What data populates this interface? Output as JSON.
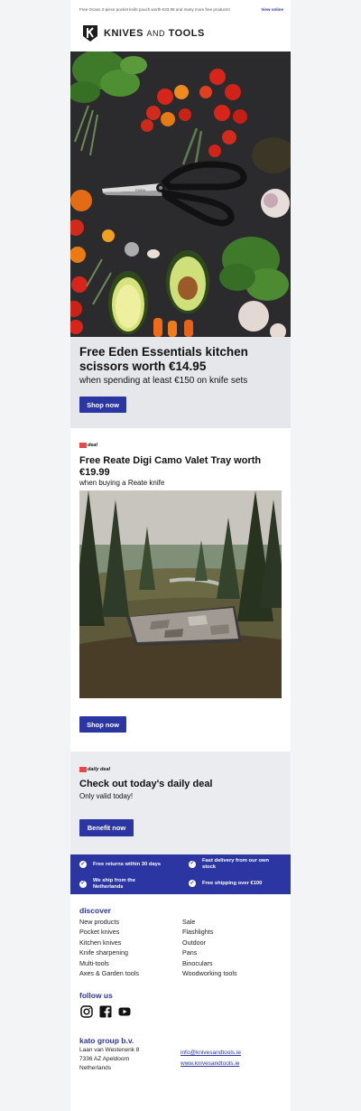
{
  "preheader": {
    "text": "Free Ocaso 2-piece pocket knife pouch worth €33.99 and many more free products!",
    "view_online": "View online"
  },
  "brand": {
    "name": "KNIVES",
    "and": "AND",
    "name2": "TOOLS"
  },
  "hero": {
    "scissors_mark": "EDEN",
    "title": "Free Eden Essentials kitchen scissors worth €14.95",
    "subtitle": "when spending at least €150 on knife sets",
    "button": "Shop now"
  },
  "deal": {
    "tag": "deal",
    "title": "Free Reate Digi Camo Valet Tray worth €19.99",
    "subtitle": "when buying a Reate knife",
    "button": "Shop now"
  },
  "daily_deal": {
    "tag": "daily deal",
    "title": "Check out today's daily deal",
    "subtitle": "Only valid today!",
    "button": "Benefit now"
  },
  "usps": [
    "Free returns within 30 days",
    "Fast delivery from our own stock",
    "We ship from the Netherlands",
    "Free shipping over €100"
  ],
  "discover": {
    "title": "discover",
    "col1": [
      "New products",
      "Pocket knives",
      "Kitchen knives",
      "Knife sharpening",
      "Multi-tools",
      "Axes & Garden tools"
    ],
    "col2": [
      "Sale",
      "Flashlights",
      "Outdoor",
      "Pans",
      "Binoculars",
      "Woodworking tools"
    ]
  },
  "follow": {
    "title": "follow us"
  },
  "company": {
    "title": "kato group b.v.",
    "street": "Laan van Westenenk 8",
    "city": "7336 AZ Apeldoorn",
    "country": "Netherlands",
    "email": "info@knivesandtools.ie",
    "website": "www.knivesandtools.ie"
  },
  "colors": {
    "accent": "#2b36a3",
    "tag_red": "#e84848",
    "band": "#e6e7eb"
  }
}
